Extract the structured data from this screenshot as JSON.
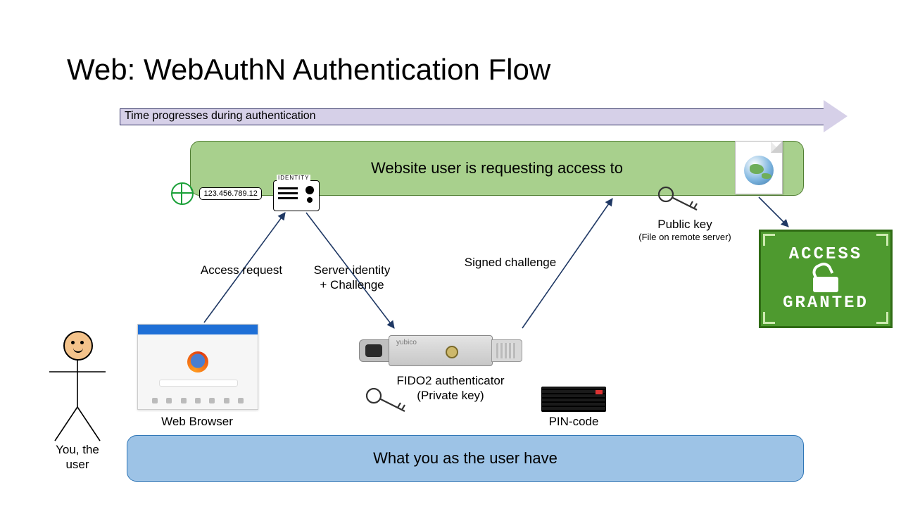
{
  "title": "Web: WebAuthN Authentication Flow",
  "time_arrow_label": "Time progresses during authentication",
  "website_box": "Website user is requesting access to",
  "user_has_box": "What you as the user have",
  "ip_address": "123.456.789.12",
  "identity_card_label": "IDENTITY",
  "public_key": {
    "title": "Public key",
    "subtitle": "(File on remote server)"
  },
  "labels": {
    "access_request": "Access request",
    "server_identity": "Server identity",
    "plus_challenge": "+     Challenge",
    "signed_challenge": "Signed challenge",
    "fido_top": "FIDO2 authenticator",
    "fido_bottom": "(Private key)",
    "pin_code": "PIN-code",
    "web_browser": "Web Browser",
    "you_user_1": "You, the",
    "you_user_2": "user"
  },
  "access_badge": {
    "line1": "ACCESS",
    "line2": "GRANTED"
  },
  "yubikey_brand": "yubico"
}
